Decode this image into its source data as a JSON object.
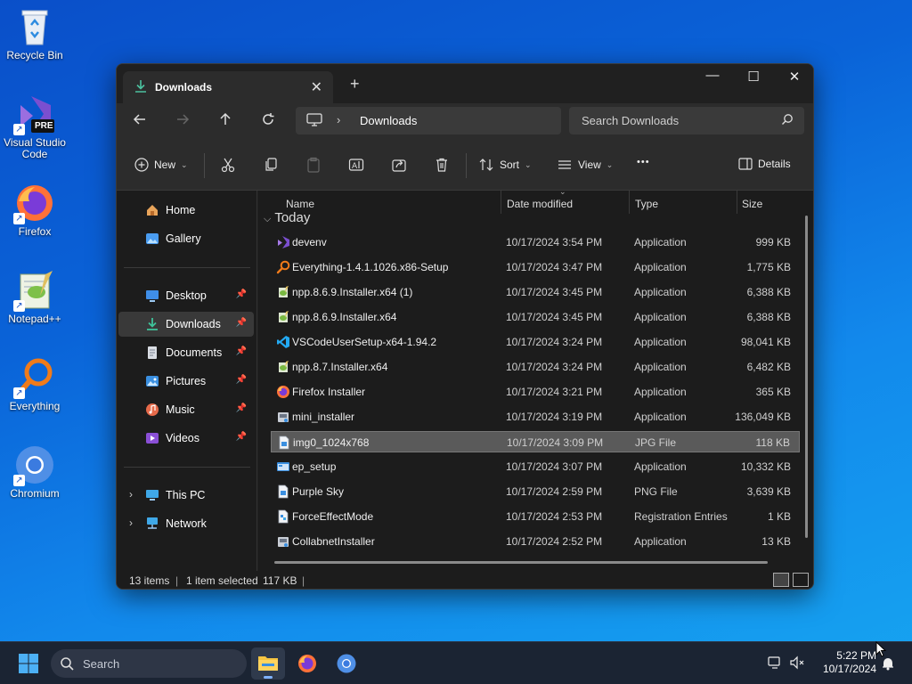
{
  "desktop": {
    "icons": [
      {
        "label": "Recycle Bin",
        "icon": "recycle-bin-icon"
      },
      {
        "label": "Visual Studio Code",
        "icon": "visual-studio-icon",
        "badge": "PRE"
      },
      {
        "label": "Firefox",
        "icon": "firefox-icon"
      },
      {
        "label": "Notepad++",
        "icon": "notepadpp-icon"
      },
      {
        "label": "Everything",
        "icon": "everything-icon"
      },
      {
        "label": "Chromium",
        "icon": "chromium-icon"
      }
    ]
  },
  "window": {
    "tab_title": "Downloads",
    "tab_close": "✕",
    "new_tab": "+",
    "controls": {
      "minimize": "—",
      "maximize": "☐",
      "close": "✕"
    },
    "address": {
      "crumb": "Downloads",
      "separator": "›"
    },
    "search_placeholder": "Search Downloads",
    "toolbar": {
      "new_label": "New",
      "sort_label": "Sort",
      "view_label": "View",
      "more_label": "•••",
      "details_label": "Details"
    },
    "sidebar": {
      "items": [
        {
          "label": "Home",
          "icon": "home-icon"
        },
        {
          "label": "Gallery",
          "icon": "gallery-icon"
        },
        {
          "label": "Desktop",
          "icon": "desktop-folder-icon",
          "pinned": true
        },
        {
          "label": "Downloads",
          "icon": "downloads-icon",
          "pinned": true,
          "selected": true
        },
        {
          "label": "Documents",
          "icon": "documents-icon",
          "pinned": true
        },
        {
          "label": "Pictures",
          "icon": "pictures-icon",
          "pinned": true
        },
        {
          "label": "Music",
          "icon": "music-icon",
          "pinned": true
        },
        {
          "label": "Videos",
          "icon": "videos-icon",
          "pinned": true
        },
        {
          "label": "This PC",
          "icon": "this-pc-icon",
          "expandable": true
        },
        {
          "label": "Network",
          "icon": "network-icon",
          "expandable": true
        }
      ]
    },
    "columns": {
      "name": "Name",
      "date": "Date modified",
      "type": "Type",
      "size": "Size"
    },
    "group": "Today",
    "files": [
      {
        "name": "devenv",
        "date": "10/17/2024 3:54 PM",
        "type": "Application",
        "size": "999 KB",
        "icon": "visual-studio-icon"
      },
      {
        "name": "Everything-1.4.1.1026.x86-Setup",
        "date": "10/17/2024 3:47 PM",
        "type": "Application",
        "size": "1,775 KB",
        "icon": "everything-icon"
      },
      {
        "name": "npp.8.6.9.Installer.x64 (1)",
        "date": "10/17/2024 3:45 PM",
        "type": "Application",
        "size": "6,388 KB",
        "icon": "notepadpp-icon"
      },
      {
        "name": "npp.8.6.9.Installer.x64",
        "date": "10/17/2024 3:45 PM",
        "type": "Application",
        "size": "6,388 KB",
        "icon": "notepadpp-icon"
      },
      {
        "name": "VSCodeUserSetup-x64-1.94.2",
        "date": "10/17/2024 3:24 PM",
        "type": "Application",
        "size": "98,041 KB",
        "icon": "vscode-icon"
      },
      {
        "name": "npp.8.7.Installer.x64",
        "date": "10/17/2024 3:24 PM",
        "type": "Application",
        "size": "6,482 KB",
        "icon": "notepadpp-icon"
      },
      {
        "name": "Firefox Installer",
        "date": "10/17/2024 3:21 PM",
        "type": "Application",
        "size": "365 KB",
        "icon": "firefox-icon"
      },
      {
        "name": "mini_installer",
        "date": "10/17/2024 3:19 PM",
        "type": "Application",
        "size": "136,049 KB",
        "icon": "installer-icon"
      },
      {
        "name": "img0_1024x768",
        "date": "10/17/2024 3:09 PM",
        "type": "JPG File",
        "size": "118 KB",
        "icon": "image-file-icon",
        "selected": true
      },
      {
        "name": "ep_setup",
        "date": "10/17/2024 3:07 PM",
        "type": "Application",
        "size": "10,332 KB",
        "icon": "app-window-icon"
      },
      {
        "name": "Purple Sky",
        "date": "10/17/2024 2:59 PM",
        "type": "PNG File",
        "size": "3,639 KB",
        "icon": "image-file-icon"
      },
      {
        "name": "ForceEffectMode",
        "date": "10/17/2024 2:53 PM",
        "type": "Registration Entries",
        "size": "1 KB",
        "icon": "registry-file-icon"
      },
      {
        "name": "CollabnetInstaller",
        "date": "10/17/2024 2:52 PM",
        "type": "Application",
        "size": "13 KB",
        "icon": "installer-icon"
      }
    ],
    "status": {
      "count": "13 items",
      "selected": "1 item selected",
      "size": "117 KB"
    }
  },
  "taskbar": {
    "search_placeholder": "Search",
    "apps": [
      "file-explorer-icon",
      "firefox-icon",
      "chromium-icon"
    ],
    "time": "5:22 PM",
    "date": "10/17/2024"
  },
  "colors": {
    "accent": "#4cc2ff",
    "window_bg": "#1f1f1f",
    "selection": "#5a5a5a"
  }
}
